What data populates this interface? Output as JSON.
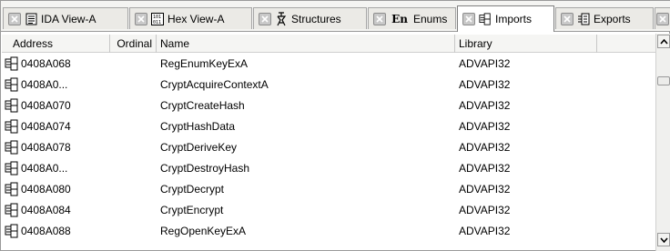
{
  "tabs": [
    {
      "label": "IDA View-A",
      "icon": "text-view-icon",
      "active": false
    },
    {
      "label": "Hex View-A",
      "icon": "hex-view-icon",
      "active": false
    },
    {
      "label": "Structures",
      "icon": "structures-icon",
      "active": false
    },
    {
      "label": "Enums",
      "icon": "enums-icon",
      "active": false
    },
    {
      "label": "Imports",
      "icon": "imports-icon",
      "active": true
    },
    {
      "label": "Exports",
      "icon": "exports-icon",
      "active": false
    }
  ],
  "enum_icon_text": "En",
  "columns": {
    "address": "Address",
    "ordinal": "Ordinal",
    "name": "Name",
    "library": "Library"
  },
  "rows": [
    {
      "address": "0408A068",
      "ordinal": "",
      "name": "RegEnumKeyExA",
      "library": "ADVAPI32"
    },
    {
      "address": "0408A0...",
      "ordinal": "",
      "name": "CryptAcquireContextA",
      "library": "ADVAPI32"
    },
    {
      "address": "0408A070",
      "ordinal": "",
      "name": "CryptCreateHash",
      "library": "ADVAPI32"
    },
    {
      "address": "0408A074",
      "ordinal": "",
      "name": "CryptHashData",
      "library": "ADVAPI32"
    },
    {
      "address": "0408A078",
      "ordinal": "",
      "name": "CryptDeriveKey",
      "library": "ADVAPI32"
    },
    {
      "address": "0408A0...",
      "ordinal": "",
      "name": "CryptDestroyHash",
      "library": "ADVAPI32"
    },
    {
      "address": "0408A080",
      "ordinal": "",
      "name": "CryptDecrypt",
      "library": "ADVAPI32"
    },
    {
      "address": "0408A084",
      "ordinal": "",
      "name": "CryptEncrypt",
      "library": "ADVAPI32"
    },
    {
      "address": "0408A088",
      "ordinal": "",
      "name": "RegOpenKeyExA",
      "library": "ADVAPI32"
    }
  ],
  "colors": {
    "tab_bg": "#ebeae6",
    "active_tab_bg": "#ffffff",
    "header_bg": "#f5f5f3",
    "border": "#9a9a9a"
  }
}
